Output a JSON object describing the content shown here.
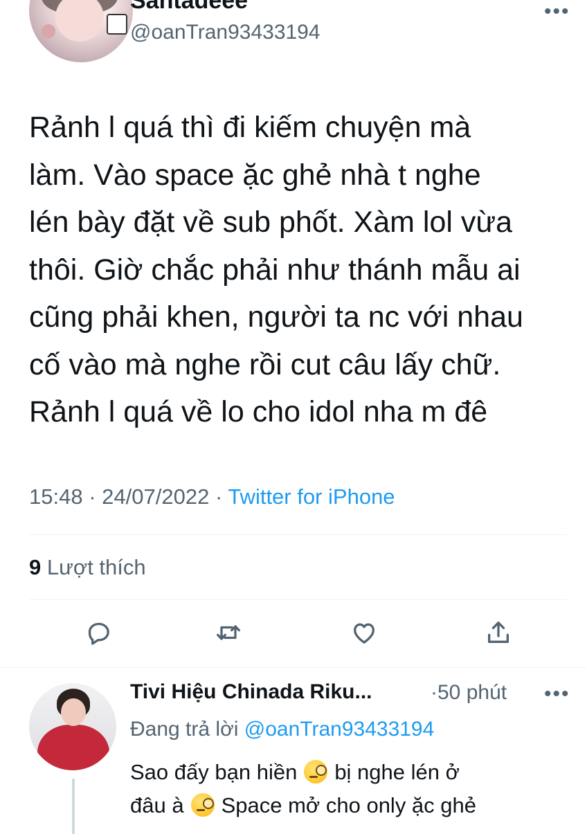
{
  "tweet": {
    "display_name": "Santadeee",
    "handle": "@oanTran93433194",
    "text_lines": [
      "Rảnh l quá thì đi kiếm chuyện mà",
      "làm. Vào space ặc ghẻ nhà t nghe",
      "lén bày đặt về sub phốt. Xàm lol vừa",
      "thôi. Giờ chắc phải như thánh mẫu ai",
      "cũng phải khen, người ta nc với nhau",
      "cố vào mà nghe rồi cut câu lấy chữ.",
      "Rảnh l quá về lo cho idol nha m đê"
    ],
    "time": "15:48",
    "date": "24/07/2022",
    "separator": "·",
    "source": "Twitter for iPhone",
    "likes_count": "9",
    "likes_label": "Lượt thích",
    "more_label": "•••"
  },
  "actions": {
    "icons": [
      "reply-icon",
      "retweet-icon",
      "like-icon",
      "share-icon"
    ]
  },
  "reply": {
    "display_name": "Tivi Hiệu Chinada Riku...",
    "time": "50 phút",
    "separator": "·",
    "more_label": "•••",
    "replying_prefix": "Đang trả lời",
    "replying_to": "@oanTran93433194",
    "line1_a": "Sao đấy bạn hiền",
    "line1_b": "bị nghe lén ở",
    "line2_a": "đâu à",
    "line2_b": "Space mở cho only ặc ghẻ",
    "emoji_name": "face-with-monocle"
  },
  "colors": {
    "text": "#0f1419",
    "secondary": "#536471",
    "link": "#1d9bf0",
    "divider": "#eff3f4"
  }
}
